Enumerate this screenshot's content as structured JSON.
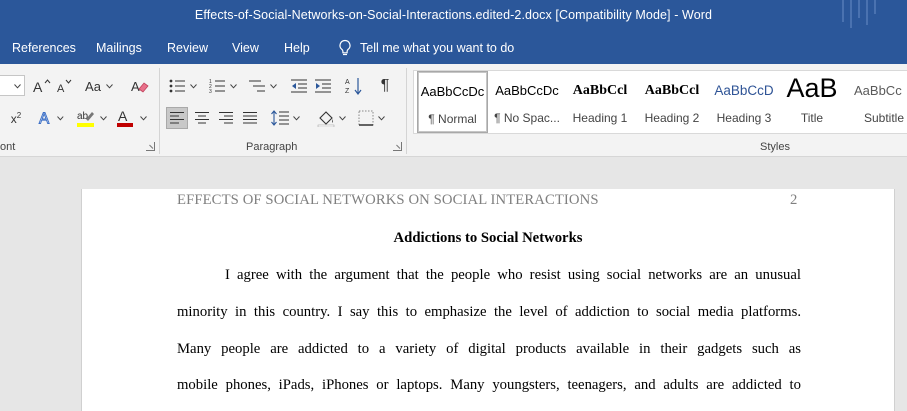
{
  "window": {
    "title": "Effects-of-Social-Networks-on-Social-Interactions.edited-2.docx [Compatibility Mode]  -  Word"
  },
  "menu": {
    "tabs": [
      "References",
      "Mailings",
      "Review",
      "View",
      "Help"
    ],
    "tell_me": "Tell me what you want to do"
  },
  "ribbon": {
    "font_group_label": "ont",
    "paragraph_group_label": "Paragraph",
    "styles_group_label": "Styles",
    "font_size_abbrev": "Aa",
    "font_color": "#c00000",
    "highlight_color": "#ffff00"
  },
  "styles": [
    {
      "preview": "AaBbCcDc",
      "label": "¶ Normal"
    },
    {
      "preview": "AaBbCcDc",
      "label": "¶ No Spac..."
    },
    {
      "preview": "AaBbCcl",
      "label": "Heading 1"
    },
    {
      "preview": "AaBbCcl",
      "label": "Heading 2"
    },
    {
      "preview": "AaBbCcD",
      "label": "Heading 3"
    },
    {
      "preview": "AaB",
      "label": "Title"
    },
    {
      "preview": "AaBbCc",
      "label": "Subtitle"
    }
  ],
  "document": {
    "running_head": "EFFECTS OF SOCIAL NETWORKS ON SOCIAL INTERACTIONS",
    "page_number": "2",
    "heading": "Addictions to Social Networks",
    "lines": [
      "I agree with the argument that the people who resist using social networks are an unusual",
      "minority in this country. I say this to emphasize the level of addiction to social media platforms.",
      "Many people are addicted to a variety of digital products available in their gadgets such as",
      "mobile phones, iPads, iPhones or laptops. Many youngsters, teenagers, and adults are addicted to"
    ]
  }
}
